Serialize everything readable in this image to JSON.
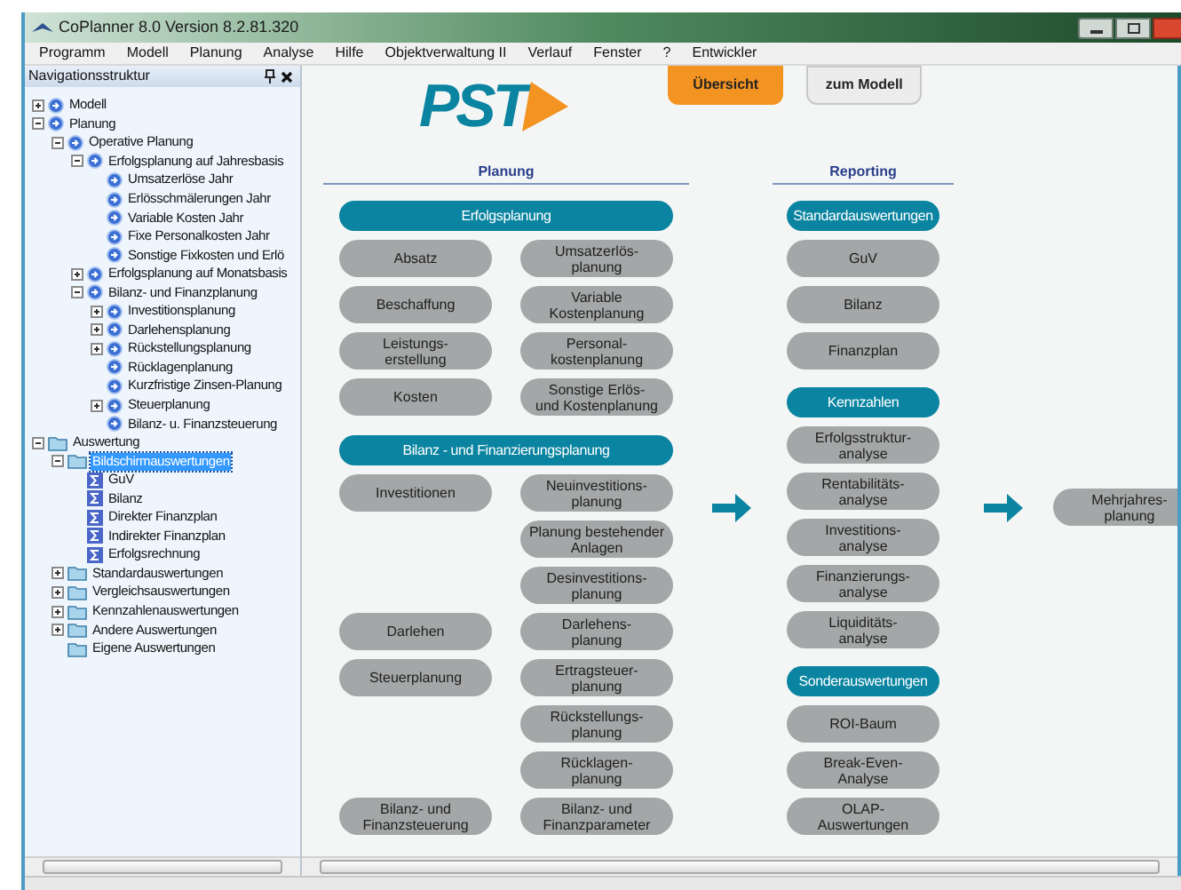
{
  "window": {
    "title": "CoPlanner 8.0 Version 8.2.81.320"
  },
  "menu": [
    "Programm",
    "Modell",
    "Planung",
    "Analyse",
    "Hilfe",
    "Objektverwaltung II",
    "Verlauf",
    "Fenster",
    "?",
    "Entwickler"
  ],
  "navigation": {
    "title": "Navigationsstruktur",
    "tree": [
      {
        "label": "Modell",
        "kind": "module",
        "expandable": true,
        "expanded": false,
        "selected": false
      },
      {
        "label": "Planung",
        "kind": "module",
        "expandable": true,
        "expanded": true,
        "selected": false,
        "children": [
          {
            "label": "Operative Planung",
            "kind": "module",
            "expandable": true,
            "expanded": true,
            "selected": false,
            "children": [
              {
                "label": "Erfolgsplanung auf Jahresbasis",
                "kind": "module",
                "expandable": true,
                "expanded": true,
                "selected": false,
                "children": [
                  {
                    "label": "Umsatzerlöse Jahr",
                    "kind": "module",
                    "expandable": false,
                    "selected": false
                  },
                  {
                    "label": "Erlösschmälerungen Jahr",
                    "kind": "module",
                    "expandable": false,
                    "selected": false
                  },
                  {
                    "label": "Variable Kosten Jahr",
                    "kind": "module",
                    "expandable": false,
                    "selected": false
                  },
                  {
                    "label": "Fixe Personalkosten Jahr",
                    "kind": "module",
                    "expandable": false,
                    "selected": false
                  },
                  {
                    "label": "Sonstige Fixkosten und Erlö",
                    "kind": "module",
                    "expandable": false,
                    "selected": false
                  }
                ]
              },
              {
                "label": "Erfolgsplanung auf Monatsbasis",
                "kind": "module",
                "expandable": true,
                "expanded": false,
                "selected": false
              },
              {
                "label": "Bilanz- und Finanzplanung",
                "kind": "module",
                "expandable": true,
                "expanded": true,
                "selected": false,
                "children": [
                  {
                    "label": "Investitionsplanung",
                    "kind": "module",
                    "expandable": true,
                    "expanded": false,
                    "selected": false
                  },
                  {
                    "label": "Darlehensplanung",
                    "kind": "module",
                    "expandable": true,
                    "expanded": false,
                    "selected": false
                  },
                  {
                    "label": "Rückstellungsplanung",
                    "kind": "module",
                    "expandable": true,
                    "expanded": false,
                    "selected": false
                  },
                  {
                    "label": "Rücklagenplanung",
                    "kind": "module",
                    "expandable": false,
                    "selected": false
                  },
                  {
                    "label": "Kurzfristige Zinsen-Planung",
                    "kind": "module",
                    "expandable": false,
                    "selected": false
                  },
                  {
                    "label": "Steuerplanung",
                    "kind": "module",
                    "expandable": true,
                    "expanded": false,
                    "selected": false
                  },
                  {
                    "label": "Bilanz- u. Finanzsteuerung",
                    "kind": "module",
                    "expandable": false,
                    "selected": false
                  }
                ]
              }
            ]
          }
        ]
      },
      {
        "label": "Auswertung",
        "kind": "folder",
        "expandable": true,
        "expanded": true,
        "selected": false,
        "children": [
          {
            "label": "Bildschirmauswertungen",
            "kind": "folder",
            "expandable": true,
            "expanded": true,
            "selected": true,
            "children": [
              {
                "label": "GuV",
                "kind": "report",
                "expandable": false,
                "selected": false
              },
              {
                "label": "Bilanz",
                "kind": "report",
                "expandable": false,
                "selected": false
              },
              {
                "label": "Direkter Finanzplan",
                "kind": "report",
                "expandable": false,
                "selected": false
              },
              {
                "label": "Indirekter Finanzplan",
                "kind": "report",
                "expandable": false,
                "selected": false
              },
              {
                "label": "Erfolgsrechnung",
                "kind": "report",
                "expandable": false,
                "selected": false
              }
            ]
          },
          {
            "label": "Standardauswertungen",
            "kind": "folder",
            "expandable": true,
            "expanded": false,
            "selected": false
          },
          {
            "label": "Vergleichsauswertungen",
            "kind": "folder",
            "expandable": true,
            "expanded": false,
            "selected": false
          },
          {
            "label": "Kennzahlenauswertungen",
            "kind": "folder",
            "expandable": true,
            "expanded": false,
            "selected": false
          },
          {
            "label": "Andere Auswertungen",
            "kind": "folder",
            "expandable": true,
            "expanded": false,
            "selected": false
          },
          {
            "label": "Eigene Auswertungen",
            "kind": "folder",
            "expandable": false,
            "selected": false
          }
        ]
      }
    ]
  },
  "logo": {
    "text": "PST"
  },
  "tabs": [
    {
      "label": "Übersicht",
      "selected": true
    },
    {
      "label": "zum Modell",
      "selected": false
    }
  ],
  "planning": {
    "title": "Planung",
    "sections": [
      {
        "title": "Erfolgsplanung",
        "rows": [
          {
            "left": "Absatz",
            "right": "Umsatzerlös-\nplanung"
          },
          {
            "left": "Beschaffung",
            "right": "Variable\nKostenplanung"
          },
          {
            "left": "Leistungs-\nerstellung",
            "right": "Personal-\nkostenplanung"
          },
          {
            "left": "Kosten",
            "right": "Sonstige Erlös-\nund Kostenplanung"
          }
        ]
      },
      {
        "title": "Bilanz - und Finanzierungsplanung",
        "rows": [
          {
            "left": "Investitionen",
            "right": "Neuinvestitions-\nplanung"
          },
          {
            "right": "Planung bestehender\nAnlagen"
          },
          {
            "right": "Desinvestitions-\nplanung"
          },
          {
            "left": "Darlehen",
            "right": "Darlehens-\nplanung"
          },
          {
            "left": "Steuerplanung",
            "right": "Ertragsteuer-\nplanung"
          },
          {
            "right": "Rückstellungs-\nplanung"
          },
          {
            "right": "Rücklagen-\nplanung"
          },
          {
            "left": "Bilanz- und\nFinanzsteuerung",
            "right": "Bilanz- und\nFinanzparameter"
          }
        ]
      }
    ]
  },
  "reporting": {
    "title": "Reporting",
    "sections": [
      {
        "title": "Standardauswertungen",
        "items": [
          "GuV",
          "Bilanz",
          "Finanzplan"
        ]
      },
      {
        "title": "Kennzahlen",
        "items": [
          "Erfolgsstruktur-\nanalyse",
          "Rentabilitäts-\nanalyse",
          "Investitions-\nanalyse",
          "Finanzierungs-\nanalyse",
          "Liquiditäts-\nanalyse"
        ]
      },
      {
        "title": "Sonderauswertungen",
        "items": [
          "ROI-Baum",
          "Break-Even-\nAnalyse",
          "OLAP-\nAuswertungen"
        ]
      }
    ]
  },
  "next_step": {
    "label": "Mehrjahres-\nplanung"
  }
}
